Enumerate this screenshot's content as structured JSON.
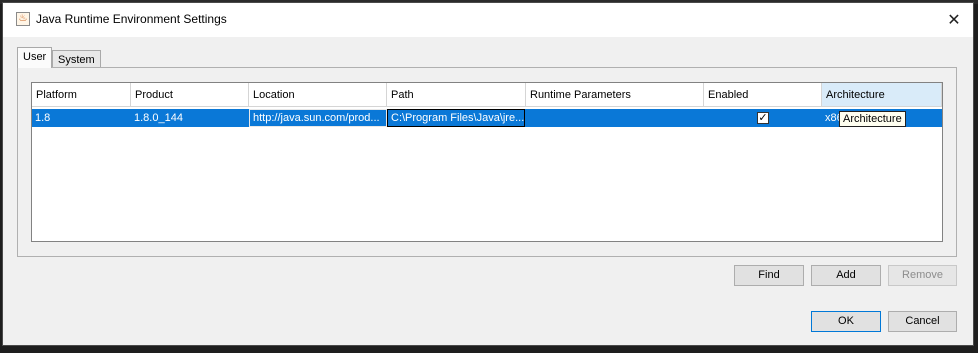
{
  "window": {
    "title": "Java Runtime Environment Settings",
    "close_glyph": "✕",
    "app_icon_glyph": "♨"
  },
  "tabs": [
    {
      "label": "User",
      "selected": true
    },
    {
      "label": "System",
      "selected": false
    }
  ],
  "table": {
    "columns": [
      "Platform",
      "Product",
      "Location",
      "Path",
      "Runtime Parameters",
      "Enabled",
      "Architecture"
    ],
    "hovered_column": "Architecture",
    "rows": [
      {
        "platform": "1.8",
        "product": "1.8.0_144",
        "location": "http://java.sun.com/prod...",
        "path": "C:\\Program Files\\Java\\jre...",
        "runtime_parameters": "",
        "enabled": true,
        "architecture": "x86_64",
        "selected": true
      }
    ],
    "tooltip": "Architecture",
    "check_glyph": "✓"
  },
  "buttons": {
    "find": "Find",
    "add": "Add",
    "remove": "Remove",
    "ok": "OK",
    "cancel": "Cancel"
  },
  "colors": {
    "selection": "#0a78d7",
    "header_hover": "#d9ebf9"
  }
}
